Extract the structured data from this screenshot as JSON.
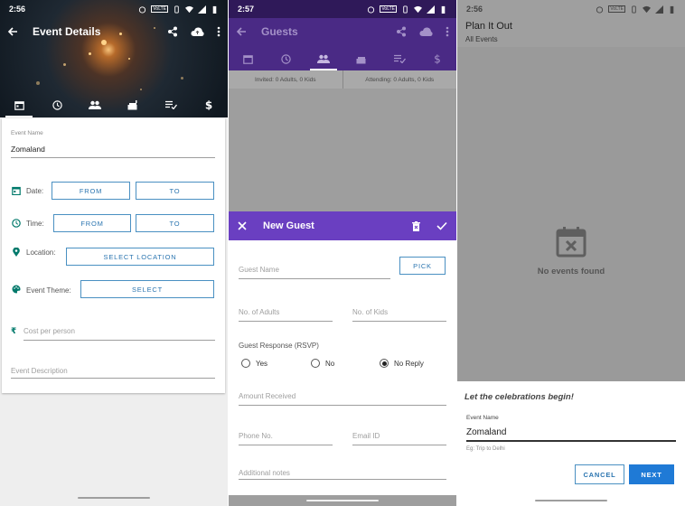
{
  "colors": {
    "accent_blue": "#2b75b0",
    "teal": "#00796b",
    "purple_dark": "#4a2a85",
    "purple_dialog": "#6a3fc1",
    "next_button": "#1f7ad6"
  },
  "panel1": {
    "status_time": "2:56",
    "toolbar_title": "Event Details",
    "tabs": [
      "calendar-icon",
      "clock-icon",
      "people-icon",
      "cake-icon",
      "checklist-icon",
      "dollar-icon"
    ],
    "event_name_label": "Event Name",
    "event_name_value": "Zomaland",
    "date_label": "Date:",
    "time_label": "Time:",
    "from_label": "FROM",
    "to_label": "TO",
    "location_label": "Location:",
    "select_location_label": "SELECT LOCATION",
    "theme_label": "Event Theme:",
    "select_label": "SELECT",
    "cost_placeholder": "Cost per person",
    "cost_symbol": "₹",
    "description_placeholder": "Event Description"
  },
  "panel2": {
    "status_time": "2:57",
    "toolbar_title": "Guests",
    "invited_text": "Invited: 0 Adults, 0 Kids",
    "attending_text": "Attending: 0 Adults, 0 Kids",
    "dialog_title": "New Guest",
    "guest_name_placeholder": "Guest Name",
    "pick_label": "PICK",
    "adults_placeholder": "No. of Adults",
    "kids_placeholder": "No. of Kids",
    "rsvp_label": "Guest Response (RSVP)",
    "rsvp_options": [
      "Yes",
      "No",
      "No Reply"
    ],
    "rsvp_selected": "No Reply",
    "amount_placeholder": "Amount Received",
    "phone_placeholder": "Phone No.",
    "email_placeholder": "Email ID",
    "notes_placeholder": "Additional notes"
  },
  "panel3": {
    "status_time": "2:56",
    "app_title": "Plan It Out",
    "app_subtitle": "All Events",
    "empty_text": "No events found",
    "sheet_title": "Let the celebrations begin!",
    "event_name_label": "Event Name",
    "event_name_value": "Zomaland",
    "hint": "Eg: Trip to Delhi",
    "cancel_label": "CANCEL",
    "next_label": "NEXT"
  }
}
